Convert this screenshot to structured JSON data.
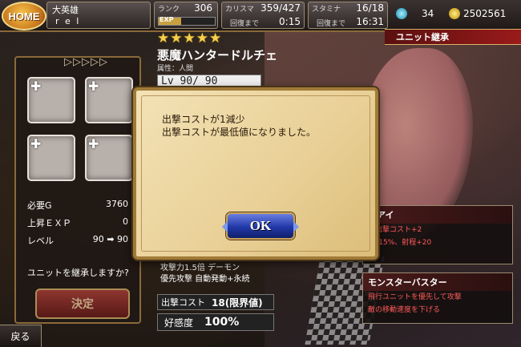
{
  "topbar": {
    "home_label": "HOME",
    "player_title": "大英雄",
    "player_name": "r e l",
    "rank_label": "ランク",
    "rank_value": "306",
    "exp_label": "EXP",
    "charisma_label": "カリスマ",
    "charisma_value": "359/427",
    "charisma_recover_label": "回復まで",
    "charisma_recover_time": "0:15",
    "stamina_label": "スタミナ",
    "stamina_value": "16/18",
    "stamina_recover_label": "回復まで",
    "stamina_recover_time": "16:31",
    "crystals": "34",
    "gold": "2502561"
  },
  "screen_title": "ユニット継承",
  "left_panel": {
    "arrows": "▷▷▷▷▷",
    "slot_plus": "✚",
    "required_gold_label": "必要G",
    "required_gold_value": "3760",
    "exp_up_label": "上昇ＥＸＰ",
    "exp_up_value": "0",
    "level_label": "レベル",
    "level_value": "90 ➡ 90",
    "confirm_text": "ユニットを継承しますか?",
    "decide_label": "決定"
  },
  "back_label": "戻る",
  "unit": {
    "stars": "★★★★★",
    "name": "悪魔ハンタードルチェ",
    "attribute": "属性：人間",
    "level": "Lv 90/ 90",
    "skill_line1": "攻撃力1.5倍 デーモン",
    "skill_line2": "優先攻撃 自動発動+永続",
    "cost_label": "出撃コスト",
    "cost_value": "18(限界値)",
    "affection_label": "好感度",
    "affection_value": "100%"
  },
  "skills": [
    {
      "title": "クアイ",
      "line1": "の出撃コスト+2",
      "line2": "0+15%、射程+20"
    },
    {
      "title": "モンスターバスター",
      "line1": "飛行ユニットを優先して攻撃",
      "line2": "敵の移動速度を下げる"
    }
  ],
  "dialog": {
    "line1": "出撃コストが1減少",
    "line2": "出撃コストが最低値になりました。",
    "ok_label": "OK"
  }
}
